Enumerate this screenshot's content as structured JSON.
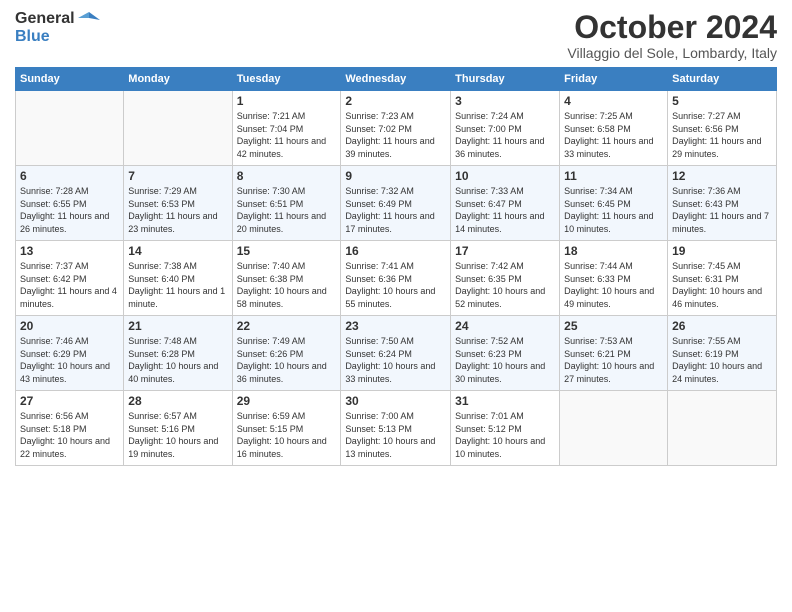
{
  "logo": {
    "general": "General",
    "blue": "Blue"
  },
  "title": "October 2024",
  "subtitle": "Villaggio del Sole, Lombardy, Italy",
  "headers": [
    "Sunday",
    "Monday",
    "Tuesday",
    "Wednesday",
    "Thursday",
    "Friday",
    "Saturday"
  ],
  "weeks": [
    [
      {
        "day": "",
        "sunrise": "",
        "sunset": "",
        "daylight": ""
      },
      {
        "day": "",
        "sunrise": "",
        "sunset": "",
        "daylight": ""
      },
      {
        "day": "1",
        "sunrise": "Sunrise: 7:21 AM",
        "sunset": "Sunset: 7:04 PM",
        "daylight": "Daylight: 11 hours and 42 minutes."
      },
      {
        "day": "2",
        "sunrise": "Sunrise: 7:23 AM",
        "sunset": "Sunset: 7:02 PM",
        "daylight": "Daylight: 11 hours and 39 minutes."
      },
      {
        "day": "3",
        "sunrise": "Sunrise: 7:24 AM",
        "sunset": "Sunset: 7:00 PM",
        "daylight": "Daylight: 11 hours and 36 minutes."
      },
      {
        "day": "4",
        "sunrise": "Sunrise: 7:25 AM",
        "sunset": "Sunset: 6:58 PM",
        "daylight": "Daylight: 11 hours and 33 minutes."
      },
      {
        "day": "5",
        "sunrise": "Sunrise: 7:27 AM",
        "sunset": "Sunset: 6:56 PM",
        "daylight": "Daylight: 11 hours and 29 minutes."
      }
    ],
    [
      {
        "day": "6",
        "sunrise": "Sunrise: 7:28 AM",
        "sunset": "Sunset: 6:55 PM",
        "daylight": "Daylight: 11 hours and 26 minutes."
      },
      {
        "day": "7",
        "sunrise": "Sunrise: 7:29 AM",
        "sunset": "Sunset: 6:53 PM",
        "daylight": "Daylight: 11 hours and 23 minutes."
      },
      {
        "day": "8",
        "sunrise": "Sunrise: 7:30 AM",
        "sunset": "Sunset: 6:51 PM",
        "daylight": "Daylight: 11 hours and 20 minutes."
      },
      {
        "day": "9",
        "sunrise": "Sunrise: 7:32 AM",
        "sunset": "Sunset: 6:49 PM",
        "daylight": "Daylight: 11 hours and 17 minutes."
      },
      {
        "day": "10",
        "sunrise": "Sunrise: 7:33 AM",
        "sunset": "Sunset: 6:47 PM",
        "daylight": "Daylight: 11 hours and 14 minutes."
      },
      {
        "day": "11",
        "sunrise": "Sunrise: 7:34 AM",
        "sunset": "Sunset: 6:45 PM",
        "daylight": "Daylight: 11 hours and 10 minutes."
      },
      {
        "day": "12",
        "sunrise": "Sunrise: 7:36 AM",
        "sunset": "Sunset: 6:43 PM",
        "daylight": "Daylight: 11 hours and 7 minutes."
      }
    ],
    [
      {
        "day": "13",
        "sunrise": "Sunrise: 7:37 AM",
        "sunset": "Sunset: 6:42 PM",
        "daylight": "Daylight: 11 hours and 4 minutes."
      },
      {
        "day": "14",
        "sunrise": "Sunrise: 7:38 AM",
        "sunset": "Sunset: 6:40 PM",
        "daylight": "Daylight: 11 hours and 1 minute."
      },
      {
        "day": "15",
        "sunrise": "Sunrise: 7:40 AM",
        "sunset": "Sunset: 6:38 PM",
        "daylight": "Daylight: 10 hours and 58 minutes."
      },
      {
        "day": "16",
        "sunrise": "Sunrise: 7:41 AM",
        "sunset": "Sunset: 6:36 PM",
        "daylight": "Daylight: 10 hours and 55 minutes."
      },
      {
        "day": "17",
        "sunrise": "Sunrise: 7:42 AM",
        "sunset": "Sunset: 6:35 PM",
        "daylight": "Daylight: 10 hours and 52 minutes."
      },
      {
        "day": "18",
        "sunrise": "Sunrise: 7:44 AM",
        "sunset": "Sunset: 6:33 PM",
        "daylight": "Daylight: 10 hours and 49 minutes."
      },
      {
        "day": "19",
        "sunrise": "Sunrise: 7:45 AM",
        "sunset": "Sunset: 6:31 PM",
        "daylight": "Daylight: 10 hours and 46 minutes."
      }
    ],
    [
      {
        "day": "20",
        "sunrise": "Sunrise: 7:46 AM",
        "sunset": "Sunset: 6:29 PM",
        "daylight": "Daylight: 10 hours and 43 minutes."
      },
      {
        "day": "21",
        "sunrise": "Sunrise: 7:48 AM",
        "sunset": "Sunset: 6:28 PM",
        "daylight": "Daylight: 10 hours and 40 minutes."
      },
      {
        "day": "22",
        "sunrise": "Sunrise: 7:49 AM",
        "sunset": "Sunset: 6:26 PM",
        "daylight": "Daylight: 10 hours and 36 minutes."
      },
      {
        "day": "23",
        "sunrise": "Sunrise: 7:50 AM",
        "sunset": "Sunset: 6:24 PM",
        "daylight": "Daylight: 10 hours and 33 minutes."
      },
      {
        "day": "24",
        "sunrise": "Sunrise: 7:52 AM",
        "sunset": "Sunset: 6:23 PM",
        "daylight": "Daylight: 10 hours and 30 minutes."
      },
      {
        "day": "25",
        "sunrise": "Sunrise: 7:53 AM",
        "sunset": "Sunset: 6:21 PM",
        "daylight": "Daylight: 10 hours and 27 minutes."
      },
      {
        "day": "26",
        "sunrise": "Sunrise: 7:55 AM",
        "sunset": "Sunset: 6:19 PM",
        "daylight": "Daylight: 10 hours and 24 minutes."
      }
    ],
    [
      {
        "day": "27",
        "sunrise": "Sunrise: 6:56 AM",
        "sunset": "Sunset: 5:18 PM",
        "daylight": "Daylight: 10 hours and 22 minutes."
      },
      {
        "day": "28",
        "sunrise": "Sunrise: 6:57 AM",
        "sunset": "Sunset: 5:16 PM",
        "daylight": "Daylight: 10 hours and 19 minutes."
      },
      {
        "day": "29",
        "sunrise": "Sunrise: 6:59 AM",
        "sunset": "Sunset: 5:15 PM",
        "daylight": "Daylight: 10 hours and 16 minutes."
      },
      {
        "day": "30",
        "sunrise": "Sunrise: 7:00 AM",
        "sunset": "Sunset: 5:13 PM",
        "daylight": "Daylight: 10 hours and 13 minutes."
      },
      {
        "day": "31",
        "sunrise": "Sunrise: 7:01 AM",
        "sunset": "Sunset: 5:12 PM",
        "daylight": "Daylight: 10 hours and 10 minutes."
      },
      {
        "day": "",
        "sunrise": "",
        "sunset": "",
        "daylight": ""
      },
      {
        "day": "",
        "sunrise": "",
        "sunset": "",
        "daylight": ""
      }
    ]
  ]
}
